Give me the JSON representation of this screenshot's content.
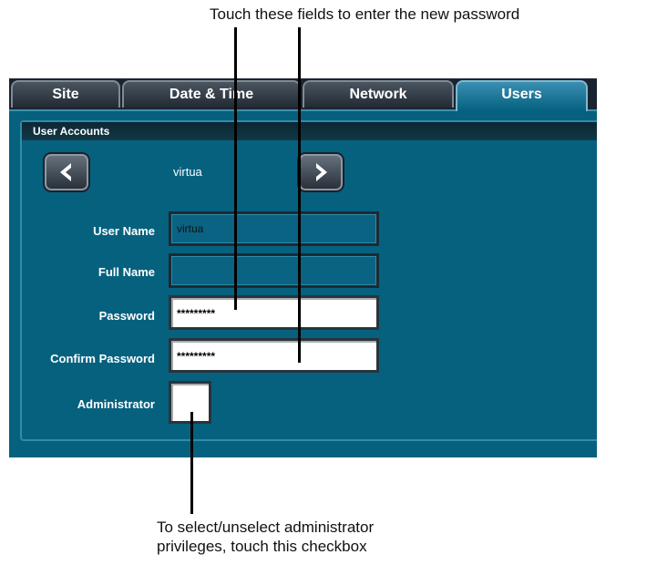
{
  "callouts": {
    "top": "Touch these fields to enter the new password",
    "bottom_line1": "To select/unselect administrator",
    "bottom_line2": "privileges, touch this checkbox"
  },
  "tabs": [
    {
      "label": "Site",
      "active": false
    },
    {
      "label": "Date & Time",
      "active": false
    },
    {
      "label": "Network",
      "active": false
    },
    {
      "label": "Users",
      "active": true
    }
  ],
  "user_accounts": {
    "title": "User Accounts",
    "prev_icon": "chevron-left-icon",
    "next_icon": "chevron-right-icon",
    "current_user": "virtua",
    "fields": {
      "user_name": {
        "label": "User Name",
        "value": "virtua"
      },
      "full_name": {
        "label": "Full Name",
        "value": ""
      },
      "password": {
        "label": "Password",
        "value": "*********"
      },
      "confirm_password": {
        "label": "Confirm Password",
        "value": "*********"
      },
      "administrator": {
        "label": "Administrator",
        "checked": false
      }
    }
  },
  "colors": {
    "panel": "#06617f",
    "active_tab": "#05607f",
    "tab_bar": "#1a2430"
  }
}
